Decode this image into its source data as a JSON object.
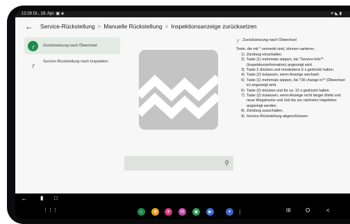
{
  "status_bar": {
    "time": "12:29",
    "date": "Di., 18. Apr.",
    "notification_icons": "▣ ◈",
    "right_icons": "✕ ◣ ▮"
  },
  "app_bar": {
    "back_icon": "arrow-back-icon",
    "breadcrumbs": [
      "Service-Rückstellung",
      "Manuelle Rückstellung",
      "Inspektionsanzeige zurücksetzen"
    ],
    "separator": ">"
  },
  "nav": {
    "items": [
      {
        "label": "Zurücksetzung nach Ölwechsel",
        "icon": "wrench-icon",
        "active": true
      },
      {
        "label": "Service-Rückstellung nach Inspektion:",
        "icon": "wrench-icon",
        "active": false
      }
    ]
  },
  "media": {
    "image_icon": "broken-image-icon",
    "search_icon": "zoom-icon"
  },
  "detail": {
    "title": "Zurücksetzung nach Ölwechsel",
    "intro": "Texte, die mit * vermerkt sind, können variieren.",
    "steps": [
      {
        "n": "1)",
        "text": "Zündung einschalten."
      },
      {
        "n": "2)",
        "text": "Taste (1) mehrmals wippen, bis \"Service-Info\"* (Inspektionsinformation) angezeigt wird."
      },
      {
        "n": "3)",
        "text": "Taste 2 drücken und mindestens 5 s gedrückt halten."
      },
      {
        "n": "4)",
        "text": "Taste (2) loslassen, wenn Anzeige wechselt."
      },
      {
        "n": "5)",
        "text": "Taste (1) mehrmals wippen, bis \"Oil change in\"* (Ölwechsel in) angezeigt wird."
      },
      {
        "n": "6)",
        "text": "Taste (2) drücken und für ca. 10 s gedrückt halten."
      },
      {
        "n": "7)",
        "text": "Taste (2) loslassen, wenn Anzeige nicht länger blinkt und neue Wegstrecke und Zeit bis zur nächsten Inspektion angezeigt werden."
      },
      {
        "n": "8)",
        "text": "Zündung ausschalten."
      },
      {
        "n": "9)",
        "text": "Service-Rückstellung abgeschlossen."
      }
    ]
  },
  "system_nav": {
    "top_left": [
      "back-arrow-icon",
      "screen-icon",
      "window-icon"
    ],
    "apps_grid": "apps-grid-icon",
    "dock": [
      {
        "name": "app-green-icon",
        "color": "#1c8f4c",
        "glyph": "⌐"
      },
      {
        "name": "app-messages-icon",
        "color": "#f0a21a",
        "glyph": "■"
      },
      {
        "name": "app-flower-icon",
        "color": "#d6357b",
        "glyph": "✲"
      },
      {
        "name": "app-gmail-icon",
        "color": "#c04aa8",
        "glyph": "M"
      },
      {
        "name": "app-chrome-icon",
        "color": "#2f9d55",
        "glyph": "◉"
      },
      {
        "name": "app-play-icon",
        "color": "#3b6fd8",
        "glyph": "▶"
      },
      {
        "name": "app-settings-icon",
        "color": "#3f63c9",
        "glyph": "✦"
      }
    ],
    "recent_label": "III",
    "home_label": "O",
    "back_label": "<"
  }
}
